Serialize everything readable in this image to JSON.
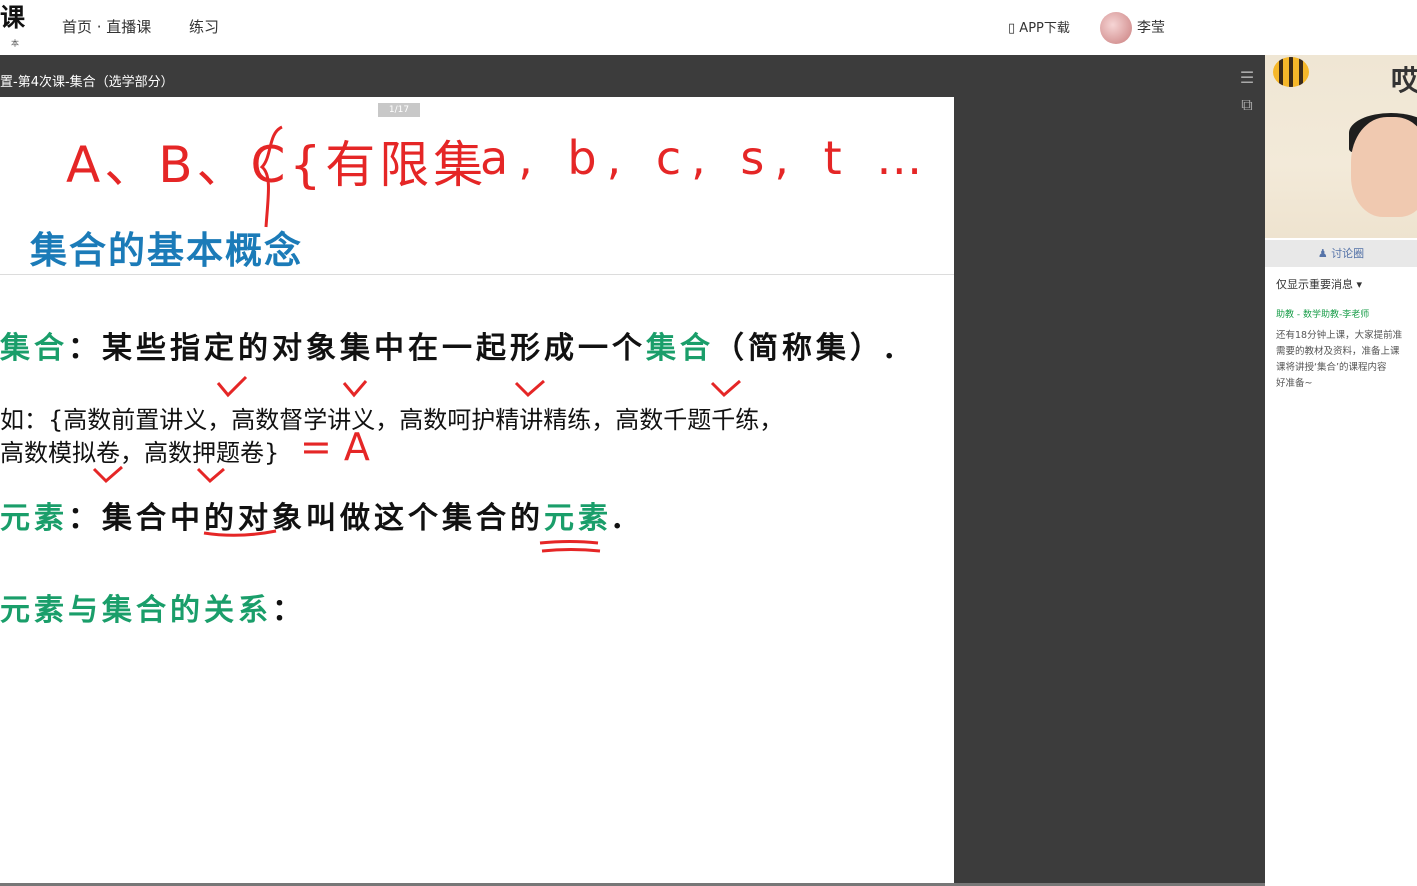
{
  "header": {
    "logo": "课",
    "logo_sub": "本",
    "nav": [
      "首页 · 直播课",
      "练习"
    ],
    "app_download": "APP下载",
    "username": "李莹"
  },
  "course_title": "置-第4次课-集合（选学部分）",
  "slide": {
    "page_indicator": "1/17",
    "handwriting_top_left": "A、B、C{有限集",
    "handwriting_top_right": "a, b, c, s, t …",
    "section_title": "集合的基本概念",
    "line1_term": "集合",
    "line1_text": "：某些指定的对象集中在一起形成一个",
    "line1_term2": "集合",
    "line1_tail": "（简称集）.",
    "example_line1": "如：{高数前置讲义，高数督学讲义，高数呵护精讲精练，高数千题千练，",
    "example_line2": "高数模拟卷，高数押题卷}",
    "example_annotation": "= A",
    "line4_term": "元素",
    "line4_text": "：集合中的对象叫做这个集合的",
    "line4_term2": "元素",
    "line4_tail": ".",
    "line5_term": "元素与集合的关系",
    "line5_tail": "："
  },
  "colors": {
    "handwriting_red": "#e52626",
    "section_blue": "#1b7bb8",
    "term_green": "#1a9e6a",
    "panel_dark": "#3c3c3c"
  },
  "sidebar": {
    "discussion_tab": "讨论圈",
    "filter_label": "仅显示重要消息",
    "sender": "助教 - 数学助教-李老师",
    "message_lines": [
      "还有18分钟上课，大家提前准",
      "需要的教材及资料，准备上课",
      "课将讲授‘集合’的课程内容",
      "好准备~"
    ]
  },
  "icons": [
    "menu-icon",
    "share-icon",
    "phone-icon",
    "chevron-down-icon",
    "users-icon"
  ]
}
